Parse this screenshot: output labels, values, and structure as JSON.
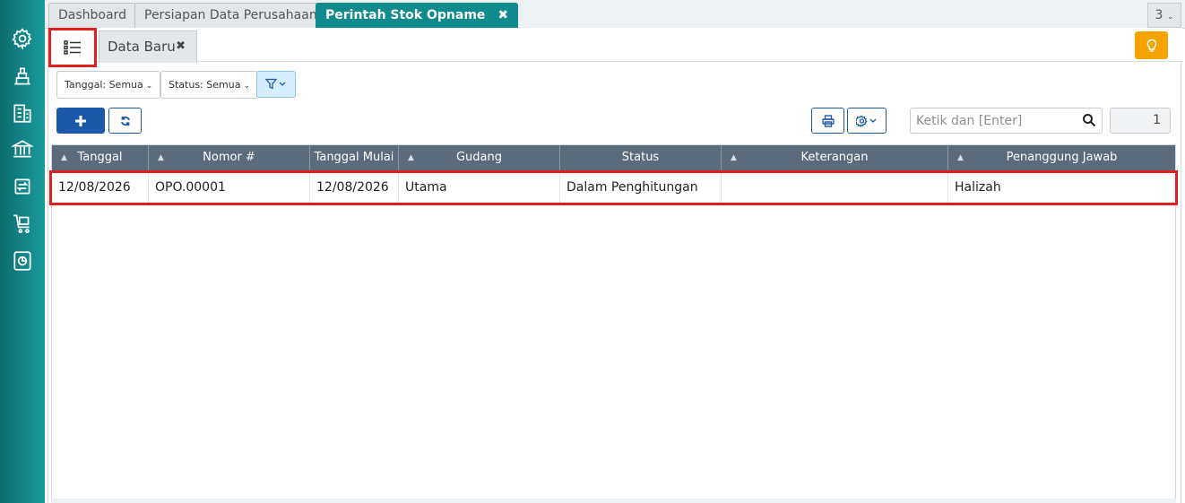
{
  "top_tabs": [
    {
      "label": "Dashboard"
    },
    {
      "label": "Persiapan Data Perusahaan"
    },
    {
      "label": "Perintah Stok Opname",
      "close": "✖"
    }
  ],
  "tab_count": "3",
  "sidebar_icons": [
    "gear-icon",
    "inventory-icon",
    "building-icon",
    "bank-icon",
    "transfer-icon",
    "cart-icon",
    "report-icon"
  ],
  "subtabs": {
    "data_baru": "Data Baru",
    "close": "✖"
  },
  "filters": {
    "tanggal": "Tanggal: Semua",
    "status": "Status: Semua"
  },
  "search": {
    "placeholder": "Ketik dan [Enter]"
  },
  "page_number": "1",
  "table": {
    "columns": [
      "Tanggal",
      "Nomor #",
      "Tanggal Mulai",
      "Gudang",
      "Status",
      "Keterangan",
      "Penanggung Jawab"
    ],
    "rows": [
      [
        "12/08/2026",
        "OPO.00001",
        "12/08/2026",
        "Utama",
        "Dalam Penghitungan",
        "",
        "Halizah"
      ]
    ]
  },
  "colors": {
    "teal": "#0f8a8d",
    "primary": "#1c59a8",
    "warning": "#f5a300",
    "header": "#5b6b7b",
    "highlight": "#e02020"
  }
}
